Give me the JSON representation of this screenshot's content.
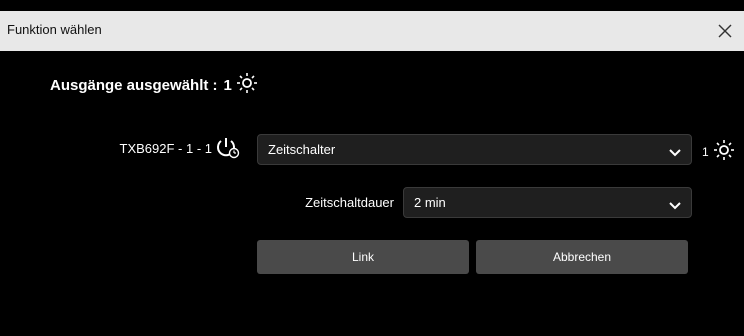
{
  "dialog": {
    "title": "Funktion wählen",
    "close_icon": "close-icon"
  },
  "selection": {
    "label": "Ausgänge ausgewählt :",
    "count": "1",
    "icon": "lamp-icon"
  },
  "row": {
    "device": "TXB692F - 1 - 1",
    "device_icon": "power-timer-icon",
    "function_value": "Zeitschalter",
    "output_count": "1",
    "output_icon": "lamp-icon"
  },
  "duration": {
    "label": "Zeitschaltdauer",
    "value": "2 min"
  },
  "buttons": {
    "link": "Link",
    "cancel": "Abbrechen"
  },
  "colors": {
    "background": "#000000",
    "titlebar": "#e8e8e8",
    "button": "#4a4a4a",
    "select": "#1f1f1f"
  }
}
